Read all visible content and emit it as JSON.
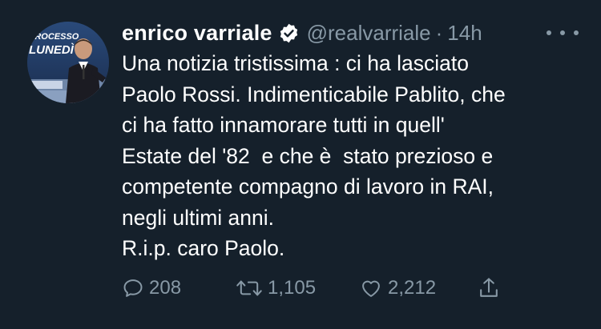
{
  "user": {
    "display_name": "enrico varriale",
    "handle": "@realvarriale",
    "separator": "·",
    "timestamp": "14h",
    "avatar_text": [
      "PROCESSO",
      "LUNEDÌ"
    ]
  },
  "tweet": {
    "lines": [
      "Una notizia tristissima : ci ha lasciato",
      "Paolo Rossi. Indimenticabile Pablito, che",
      "ci ha fatto innamorare tutti in quell'",
      "Estate del '82  e che è  stato prezioso e",
      "competente compagno di lavoro in RAI,",
      "negli ultimi anni.",
      "R.i.p. caro Paolo."
    ]
  },
  "actions": {
    "reply_count": "208",
    "retweet_count": "1,105",
    "like_count": "2,212"
  },
  "icons": {
    "verified": "verified-badge-icon",
    "more": "more-horizontal-icon",
    "reply": "reply-icon",
    "retweet": "retweet-icon",
    "like": "heart-icon",
    "share": "share-icon"
  },
  "colors": {
    "background": "#15202b",
    "primary_text": "#ffffff",
    "secondary_text": "#8899a6"
  }
}
